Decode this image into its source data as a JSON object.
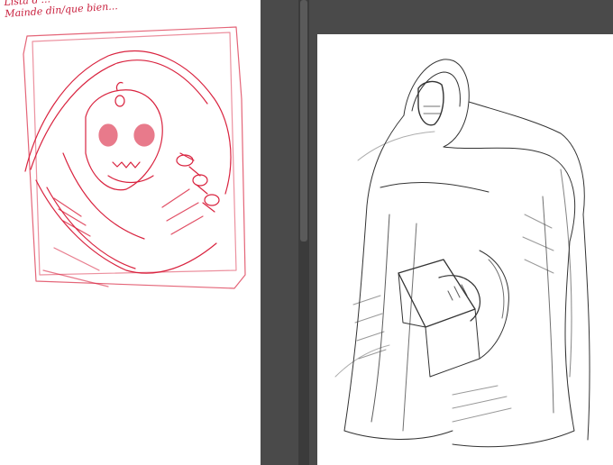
{
  "window": {
    "left_pane": {
      "name": "sketch-canvas-left"
    },
    "right_pane": {
      "name": "sketch-canvas-right"
    }
  },
  "left_canvas": {
    "handwritten_notes": [
      "Lista d'...",
      "Mainde din/que bien..."
    ],
    "ink_color": "#d9233f"
  },
  "right_canvas": {
    "ink_color": "#333333"
  },
  "colors": {
    "workspace_bg": "#4a4a4a",
    "scrollbar_track": "#3b3b3b",
    "canvas_bg": "#ffffff"
  }
}
